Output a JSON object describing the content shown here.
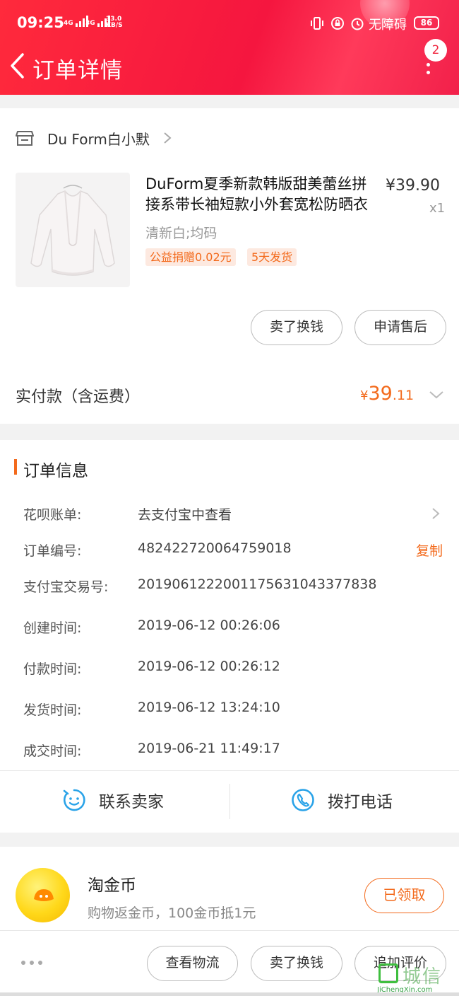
{
  "status_bar": {
    "time": "09:25",
    "sig1_label": "4G",
    "sig2_label": "3G",
    "speed_value": "33.0",
    "speed_unit": "KB/S",
    "accessibility_text": "无障碍",
    "battery": "86"
  },
  "header": {
    "title": "订单详情",
    "notification_count": "2"
  },
  "shop": {
    "name": "Du Form白小默"
  },
  "product": {
    "title": "DuForm夏季新款韩版甜美蕾丝拼接系带长袖短款小外套宽松防晒衣",
    "price": "¥39.90",
    "quantity": "x1",
    "sku": "清新白;均码",
    "tags": [
      "公益捐赠0.02元",
      "5天发货"
    ]
  },
  "product_actions": {
    "sell_label": "卖了换钱",
    "after_sale_label": "申请售后"
  },
  "payment": {
    "label": "实付款（含运费）",
    "currency": "¥",
    "amount_int": "39",
    "amount_dec": ".11"
  },
  "order_info": {
    "title": "订单信息",
    "rows": [
      {
        "label": "花呗账单:",
        "value": "去支付宝中查看"
      },
      {
        "label": "订单编号:",
        "value": "482422720064759018",
        "action": "复制"
      },
      {
        "label": "支付宝交易号:",
        "value": "2019061222001175631043377838"
      },
      {
        "label": "创建时间:",
        "value": "2019-06-12 00:26:06"
      },
      {
        "label": "付款时间:",
        "value": "2019-06-12 00:26:12"
      },
      {
        "label": "发货时间:",
        "value": "2019-06-12 13:24:10"
      },
      {
        "label": "成交时间:",
        "value": "2019-06-21 11:49:17"
      }
    ],
    "contact_seller": "联系卖家",
    "call_phone": "拨打电话"
  },
  "coins": {
    "title": "淘金币",
    "subtitle": "购物返金币，100金币抵1元",
    "button": "已领取"
  },
  "bottom_bar": {
    "logistics": "查看物流",
    "sell": "卖了换钱",
    "add_review": "追加评价"
  },
  "watermark": {
    "text": "城信",
    "url": "JiChengXin.com"
  },
  "colors": {
    "brand_red": "#f5163f",
    "accent_orange": "#f36a1c",
    "icon_blue": "#2aa3e8"
  }
}
